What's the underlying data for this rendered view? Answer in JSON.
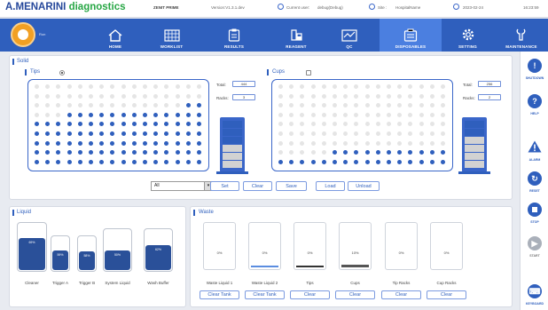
{
  "header": {
    "brand_main": "A.MENARINI",
    "brand_accent": "diagnostics",
    "instrument": "ZENIT PRIME",
    "version": "Version:V1.3.1.dev",
    "user_label": "Current user:",
    "user_value": "debug(Debug)",
    "site_label": "Site :",
    "site_value": "HospitalName",
    "date": "2023-02-24",
    "time": "16:23:59"
  },
  "nav": {
    "run_label": "Run",
    "items": [
      {
        "label": "HOME",
        "icon": "home-icon"
      },
      {
        "label": "WORKLIST",
        "icon": "worklist-icon"
      },
      {
        "label": "RESULTS",
        "icon": "results-icon"
      },
      {
        "label": "REAGENT",
        "icon": "reagent-icon"
      },
      {
        "label": "QC",
        "icon": "qc-icon"
      },
      {
        "label": "DISPOSABLES",
        "icon": "disposables-icon"
      },
      {
        "label": "SETTING",
        "icon": "gear-icon"
      },
      {
        "label": "MAINTENANCE",
        "icon": "wrench-icon"
      }
    ],
    "active": "DISPOSABLES"
  },
  "sidebar": {
    "items": [
      {
        "label": "SHUTDOWN",
        "icon": "shutdown-icon"
      },
      {
        "label": "HELP",
        "icon": "help-icon"
      },
      {
        "label": "ALARM",
        "icon": "alarm-icon"
      },
      {
        "label": "RESET",
        "icon": "reset-icon"
      },
      {
        "label": "STOP",
        "icon": "stop-icon"
      },
      {
        "label": "START",
        "icon": "start-icon"
      },
      {
        "label": "KEYBOARD",
        "icon": "keyboard-icon"
      }
    ]
  },
  "solid": {
    "title": "Solid",
    "tips": {
      "label": "Tips",
      "total_label": "Total:",
      "total_value": "444",
      "racks_label": "Racks:",
      "racks_value": "3",
      "tower_filled_rows": 3,
      "tower_rows": 6
    },
    "cups": {
      "label": "Cups",
      "total_label": "Total:",
      "total_value": "256",
      "racks_label": "Racks:",
      "racks_value": "2",
      "tower_filled_rows": 2,
      "tower_rows": 6
    },
    "select_value": "All",
    "buttons": {
      "set": "Set",
      "clear": "Clear",
      "save": "Save",
      "load": "Load",
      "unload": "Unload"
    }
  },
  "liquid": {
    "title": "Liquid",
    "bottles": [
      {
        "label": "Cleaner",
        "pct": "69%",
        "level": 0.69
      },
      {
        "label": "Trigger A",
        "pct": "59%",
        "level": 0.59
      },
      {
        "label": "Trigger B",
        "pct": "58%",
        "level": 0.58
      },
      {
        "label": "System Liquid",
        "pct": "50%",
        "level": 0.5
      },
      {
        "label": "Wash Buffer",
        "pct": "62%",
        "level": 0.62
      }
    ]
  },
  "waste": {
    "title": "Waste",
    "items": [
      {
        "label": "Waste Liquid 1",
        "pct": "0%",
        "level": 0.0,
        "button": "Clear Tank"
      },
      {
        "label": "Waste Liquid 2",
        "pct": "0%",
        "level": 0.02,
        "button": "Clear Tank"
      },
      {
        "label": "Tips",
        "pct": "0%",
        "level": 0.02,
        "button": "Clear"
      },
      {
        "label": "Cups",
        "pct": "10%",
        "level": 0.1,
        "button": "Clear"
      },
      {
        "label": "Tip Racks",
        "pct": "0%",
        "level": 0.0,
        "button": "Clear"
      },
      {
        "label": "Cup Racks",
        "pct": "0%",
        "level": 0.0,
        "button": "Clear"
      }
    ]
  },
  "colors": {
    "primary": "#2f5fbd",
    "dark_fill": "#2a5099",
    "empty_dot": "#e5e5e5",
    "run_orange": "#f2a024"
  }
}
